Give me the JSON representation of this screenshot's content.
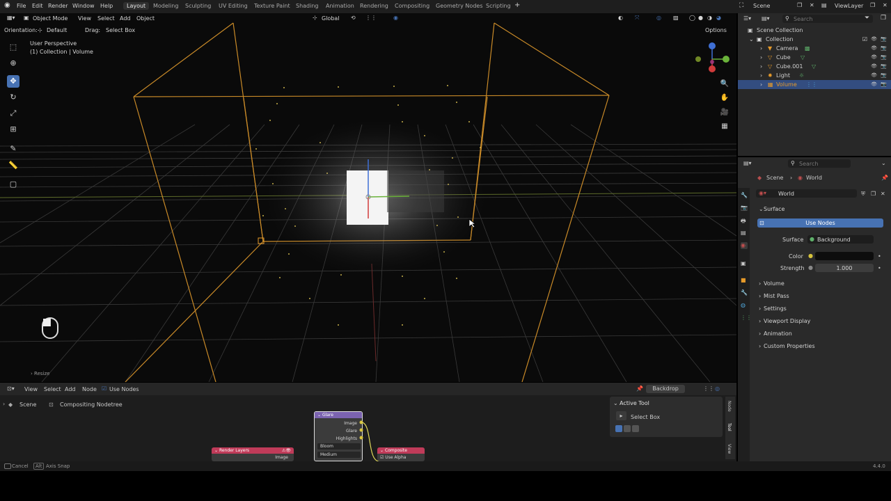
{
  "topbar": {
    "menus": [
      "File",
      "Edit",
      "Render",
      "Window",
      "Help"
    ],
    "workspaces": [
      "Layout",
      "Modeling",
      "Sculpting",
      "UV Editing",
      "Texture Paint",
      "Shading",
      "Animation",
      "Rendering",
      "Compositing",
      "Geometry Nodes",
      "Scripting"
    ],
    "active_workspace": "Layout",
    "scene": "Scene",
    "view_layer": "ViewLayer"
  },
  "viewport": {
    "mode": "Object Mode",
    "menus": [
      "View",
      "Select",
      "Add",
      "Object"
    ],
    "transform": "Global",
    "orientation_label": "Orientation:",
    "orientation_value": "Default",
    "drag_label": "Drag:",
    "drag_value": "Select Box",
    "options": "Options",
    "view_name": "User Perspective",
    "view_context": "(1) Collection | Volume",
    "last_op": "Resize"
  },
  "outliner": {
    "search_placeholder": "Search",
    "root": "Scene Collection",
    "collection": "Collection",
    "items": [
      {
        "name": "Camera"
      },
      {
        "name": "Cube"
      },
      {
        "name": "Cube.001"
      },
      {
        "name": "Light"
      },
      {
        "name": "Volume"
      }
    ]
  },
  "properties": {
    "search_placeholder": "Search",
    "breadcrumb_scene": "Scene",
    "breadcrumb_world": "World",
    "world_name": "World",
    "surface_header": "Surface",
    "use_nodes": "Use Nodes",
    "surface_label": "Surface",
    "surface_value": "Background",
    "color_label": "Color",
    "strength_label": "Strength",
    "strength_value": "1.000",
    "panels": [
      "Volume",
      "Mist Pass",
      "Settings",
      "Viewport Display",
      "Animation",
      "Custom Properties"
    ]
  },
  "node_editor": {
    "menus": [
      "View",
      "Select",
      "Add",
      "Node"
    ],
    "use_nodes": "Use Nodes",
    "backdrop": "Backdrop",
    "bc_scene": "Scene",
    "bc_tree": "Compositing Nodetree",
    "active_tool_header": "Active Tool",
    "active_tool": "Select Box",
    "side_tabs": [
      "Node",
      "Tool",
      "View"
    ],
    "glare": {
      "title": "Glare",
      "outputs": [
        "Image",
        "Glare",
        "Highlights"
      ],
      "type": "Bloom",
      "quality": "Medium"
    },
    "render_layers": {
      "title": "Render Layers",
      "output": "Image"
    },
    "composite": {
      "title": "Composite",
      "option": "Use Alpha"
    }
  },
  "statusbar": {
    "cancel": "Cancel",
    "alt_key": "Alt",
    "axis_snap": "Axis Snap",
    "version": "4.4.0"
  },
  "colors": {
    "accent": "#4772b3",
    "selection_orange": "#e69a2a",
    "node_render_layers": "#c03b59",
    "node_glare": "#7b63b0",
    "node_composite": "#c03b59"
  }
}
